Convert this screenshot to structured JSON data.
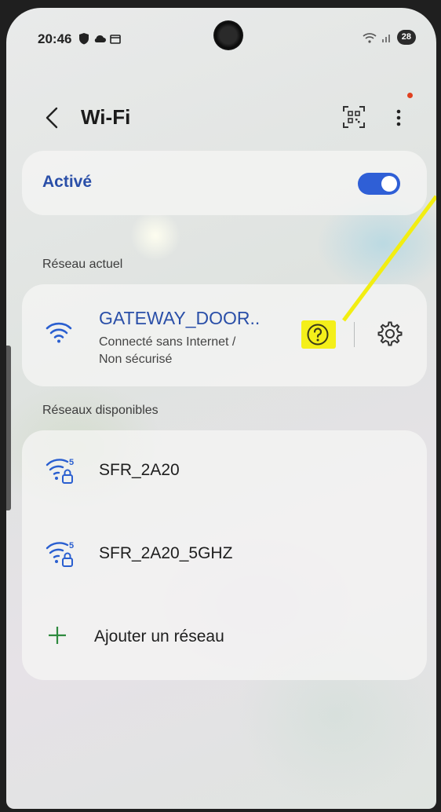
{
  "status_bar": {
    "time": "20:46",
    "battery": "28",
    "left_icons": [
      "shield-icon",
      "cloud-icon",
      "calendar-icon"
    ],
    "right_icons": [
      "wifi-signal-icon",
      "cell-signal-icon"
    ]
  },
  "header": {
    "title": "Wi-Fi",
    "back_icon": "chevron-left-icon",
    "qr_icon": "qr-code-icon",
    "more_icon": "more-vertical-icon",
    "has_notification_dot": true
  },
  "wifi_toggle": {
    "label": "Activé",
    "enabled": true,
    "accent": "#2f5fd6"
  },
  "current_network": {
    "section_label": "Réseau actuel",
    "name": "GATEWAY_DOOR..",
    "status_line1": "Connecté sans Internet /",
    "status_line2": "Non sécurisé",
    "icons": [
      "wifi-icon",
      "help-icon",
      "gear-icon"
    ],
    "highlight_color": "#f4ef1a"
  },
  "available_networks": {
    "section_label": "Réseaux disponibles",
    "items": [
      {
        "name": "SFR_2A20",
        "icon": "wifi-5ghz-lock-icon"
      },
      {
        "name": "SFR_2A20_5GHZ",
        "icon": "wifi-5ghz-lock-icon"
      }
    ],
    "add_label": "Ajouter un réseau"
  }
}
